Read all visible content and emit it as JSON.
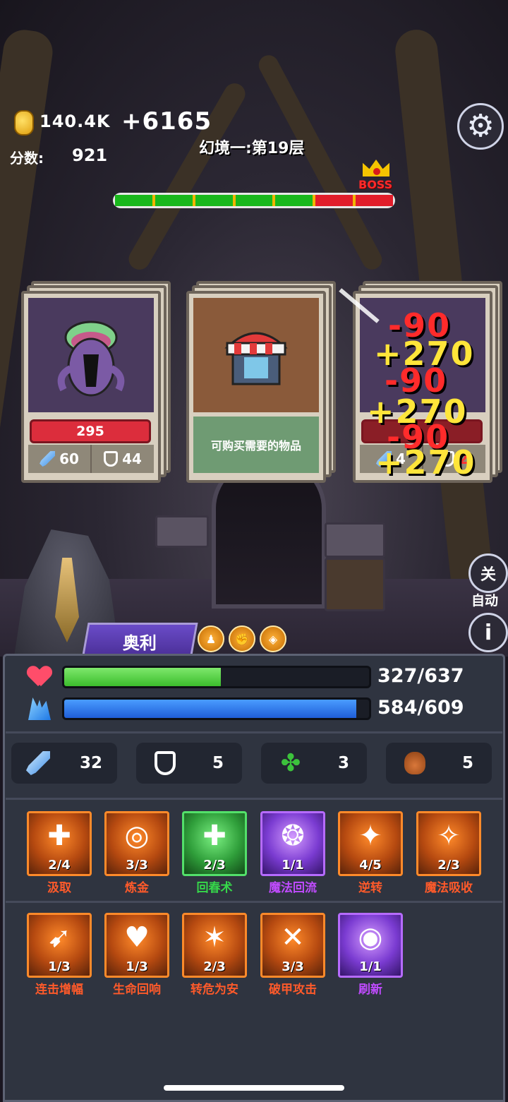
{
  "hud": {
    "coins": "140.4K",
    "coin_gain": "+6165",
    "score_label": "分数:",
    "score": "921",
    "level_name": "幻境一:第19层",
    "boss_label": "BOSS",
    "progress_segments": [
      "green",
      "green",
      "green",
      "green",
      "green",
      "red",
      "red"
    ]
  },
  "cards": {
    "monster": {
      "hp": "295",
      "attack": "60",
      "defense": "44"
    },
    "shop": {
      "description": "可购买需要的物品"
    },
    "damage_popups": [
      "-90",
      "+270",
      "-90",
      "+270",
      "-90",
      "+270"
    ],
    "right_card_partial": {
      "attack_fragment": "4",
      "defense_fragment": "2"
    }
  },
  "hero": {
    "name": "奥利",
    "buffs": [
      "person-buff-icon",
      "fist-buff-icon",
      "shield-buff-icon"
    ]
  },
  "side": {
    "auto_toggle": "关",
    "auto_label": "自动",
    "info_glyph": "i"
  },
  "player": {
    "hp_text": "327/637",
    "hp_fraction": 0.513,
    "mp_text": "584/609",
    "mp_fraction": 0.959,
    "attack": "32",
    "defense": "5",
    "luck": "3",
    "bag": "5"
  },
  "skills_row1": [
    {
      "name": "汲取",
      "count": "2/4",
      "style": "orange",
      "glyph": "✚"
    },
    {
      "name": "炼金",
      "count": "3/3",
      "style": "orange",
      "glyph": "◎"
    },
    {
      "name": "回春术",
      "count": "2/3",
      "style": "green",
      "glyph": "✚"
    },
    {
      "name": "魔法回流",
      "count": "1/1",
      "style": "purple",
      "glyph": "❂"
    },
    {
      "name": "逆转",
      "count": "4/5",
      "style": "orange",
      "glyph": "✦"
    },
    {
      "name": "魔法吸收",
      "count": "2/3",
      "style": "orange",
      "glyph": "✧"
    }
  ],
  "skills_row2": [
    {
      "name": "连击增幅",
      "count": "1/3",
      "style": "orange",
      "glyph": "➹"
    },
    {
      "name": "生命回响",
      "count": "1/3",
      "style": "orange",
      "glyph": "♥"
    },
    {
      "name": "转危为安",
      "count": "2/3",
      "style": "orange",
      "glyph": "✶"
    },
    {
      "name": "破甲攻击",
      "count": "3/3",
      "style": "orange",
      "glyph": "✕"
    },
    {
      "name": "刷新",
      "count": "1/1",
      "style": "purple",
      "glyph": "◉"
    }
  ],
  "colors": {
    "hp_bar": "#3bbd2c",
    "mp_bar": "#1f5ed8",
    "damage_negative": "#ff2b2b",
    "damage_positive": "#ffe53a"
  }
}
